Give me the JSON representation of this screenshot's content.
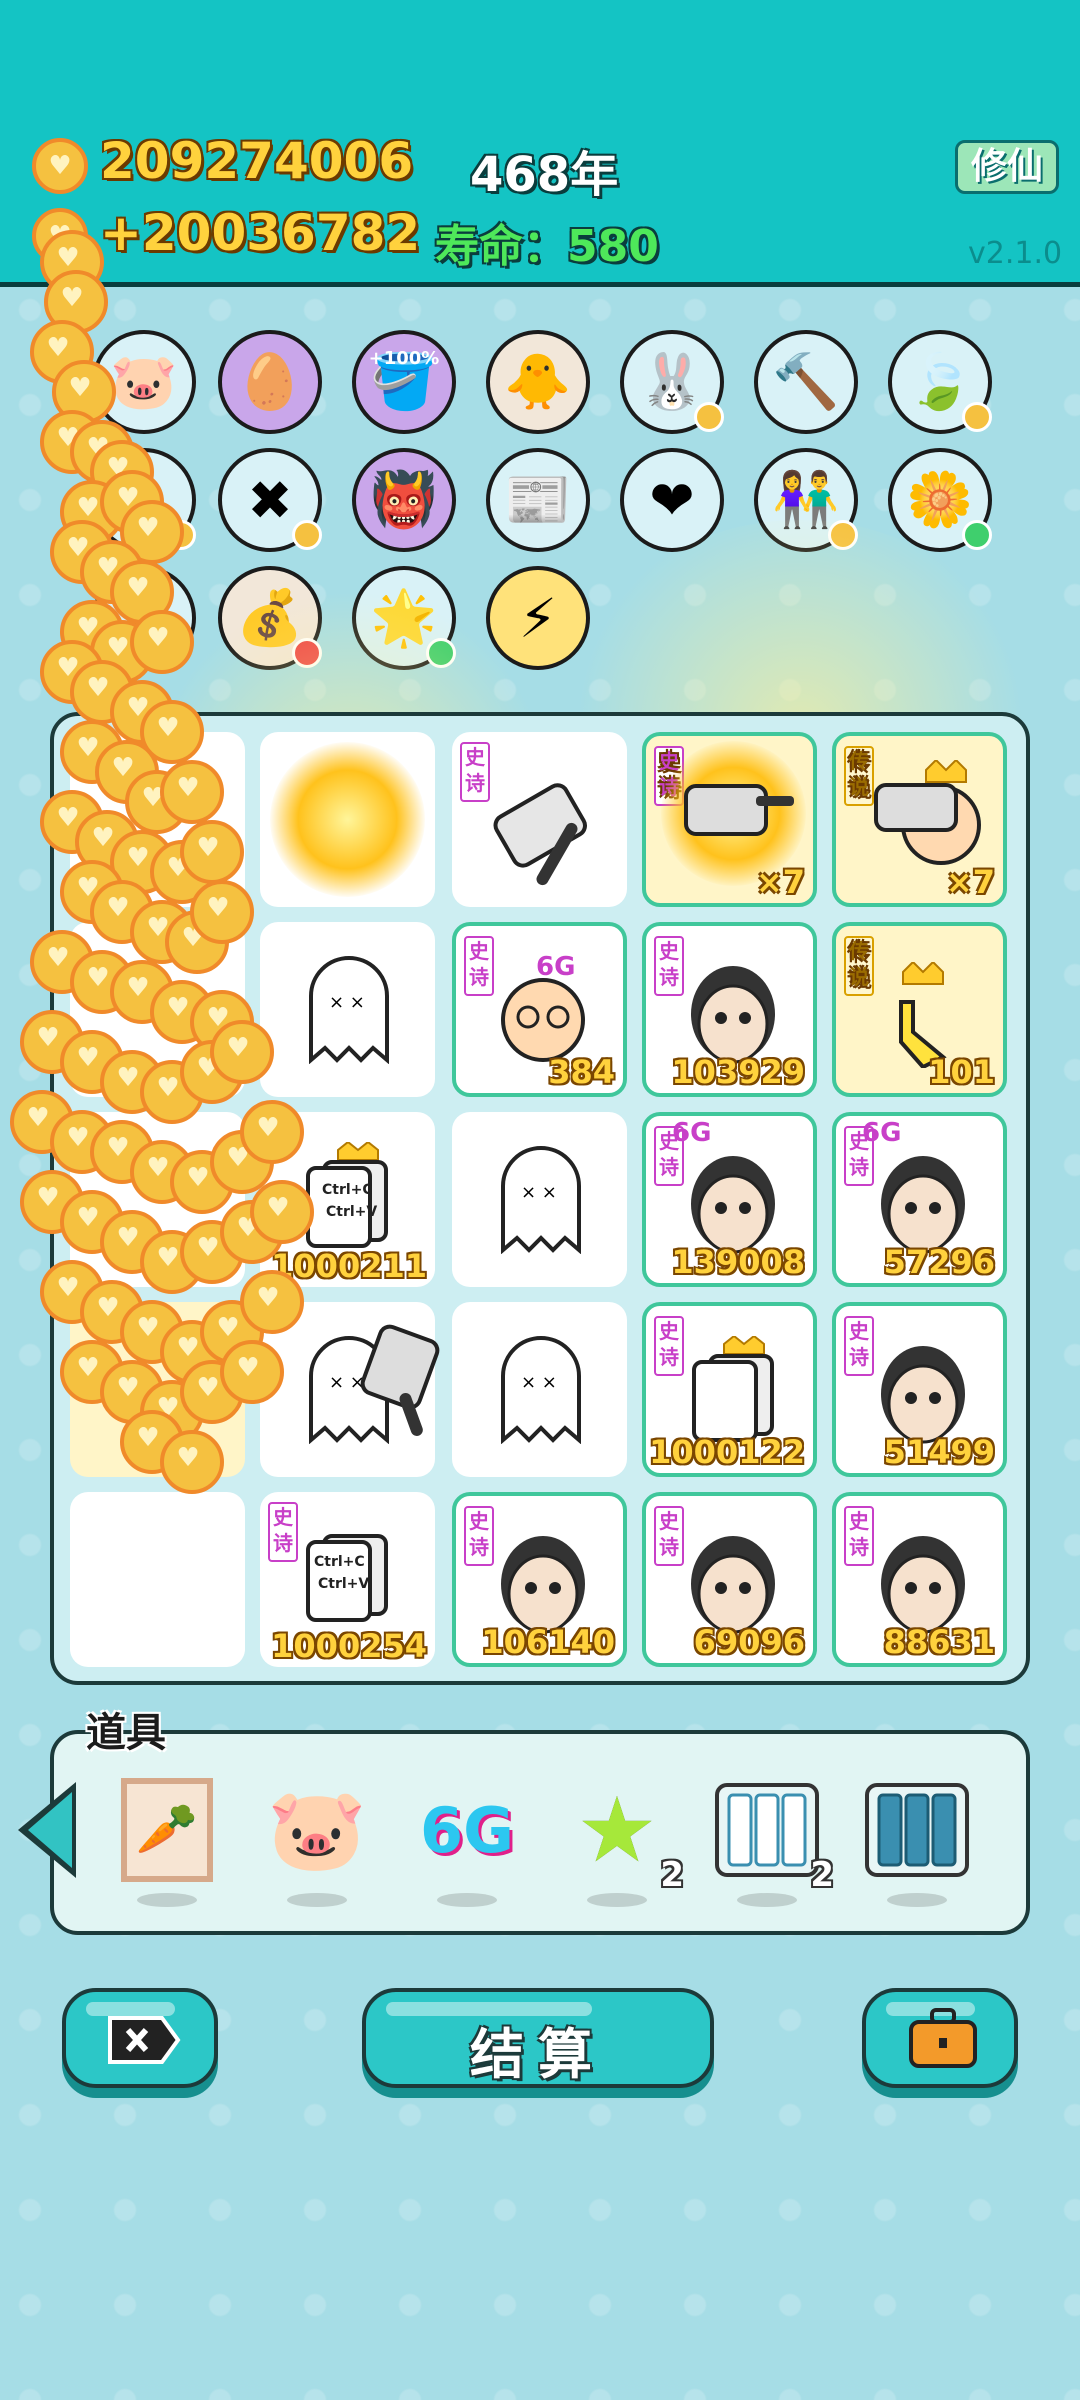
{
  "header": {
    "coins": "209274006",
    "income": "+20036782",
    "years": "468年",
    "lifespan_label": "寿命：",
    "lifespan_value": "580",
    "cultivate_button": "修仙",
    "version": "v2.1.0"
  },
  "items": {
    "double_percent_label": "+100%"
  },
  "board": {
    "cells": [
      {
        "tag": "史诗",
        "label": ""
      },
      {
        "tag": "史诗",
        "label": "×7"
      },
      {
        "tag": "传说",
        "label": "×7"
      },
      {
        "tag": "史诗",
        "label": "384"
      },
      {
        "tag": "史诗",
        "label": "103929"
      },
      {
        "tag": "传说",
        "label": "101"
      },
      {
        "tag": "",
        "label": "1000211"
      },
      {
        "tag": "史诗",
        "label": "139008"
      },
      {
        "tag": "史诗",
        "label": "57296"
      },
      {
        "tag": "史诗",
        "label": "1000122"
      },
      {
        "tag": "史诗",
        "label": "51499"
      },
      {
        "tag": "史诗",
        "label": "1000254"
      },
      {
        "tag": "史诗",
        "label": "106140"
      },
      {
        "tag": "史诗",
        "label": "69096"
      },
      {
        "tag": "史诗",
        "label": "88631"
      }
    ],
    "copy_text_1": "Ctrl+C",
    "copy_text_2": "Ctrl+V",
    "badge_6g": "6G"
  },
  "props": {
    "title": "道具",
    "g6_label": "6G",
    "star_count": "2",
    "cards_count": "2"
  },
  "buttons": {
    "settle": "结算"
  },
  "colors": {
    "teal": "#14c4c4",
    "gold": "#ffd23d",
    "green_text": "#4ee85a"
  }
}
